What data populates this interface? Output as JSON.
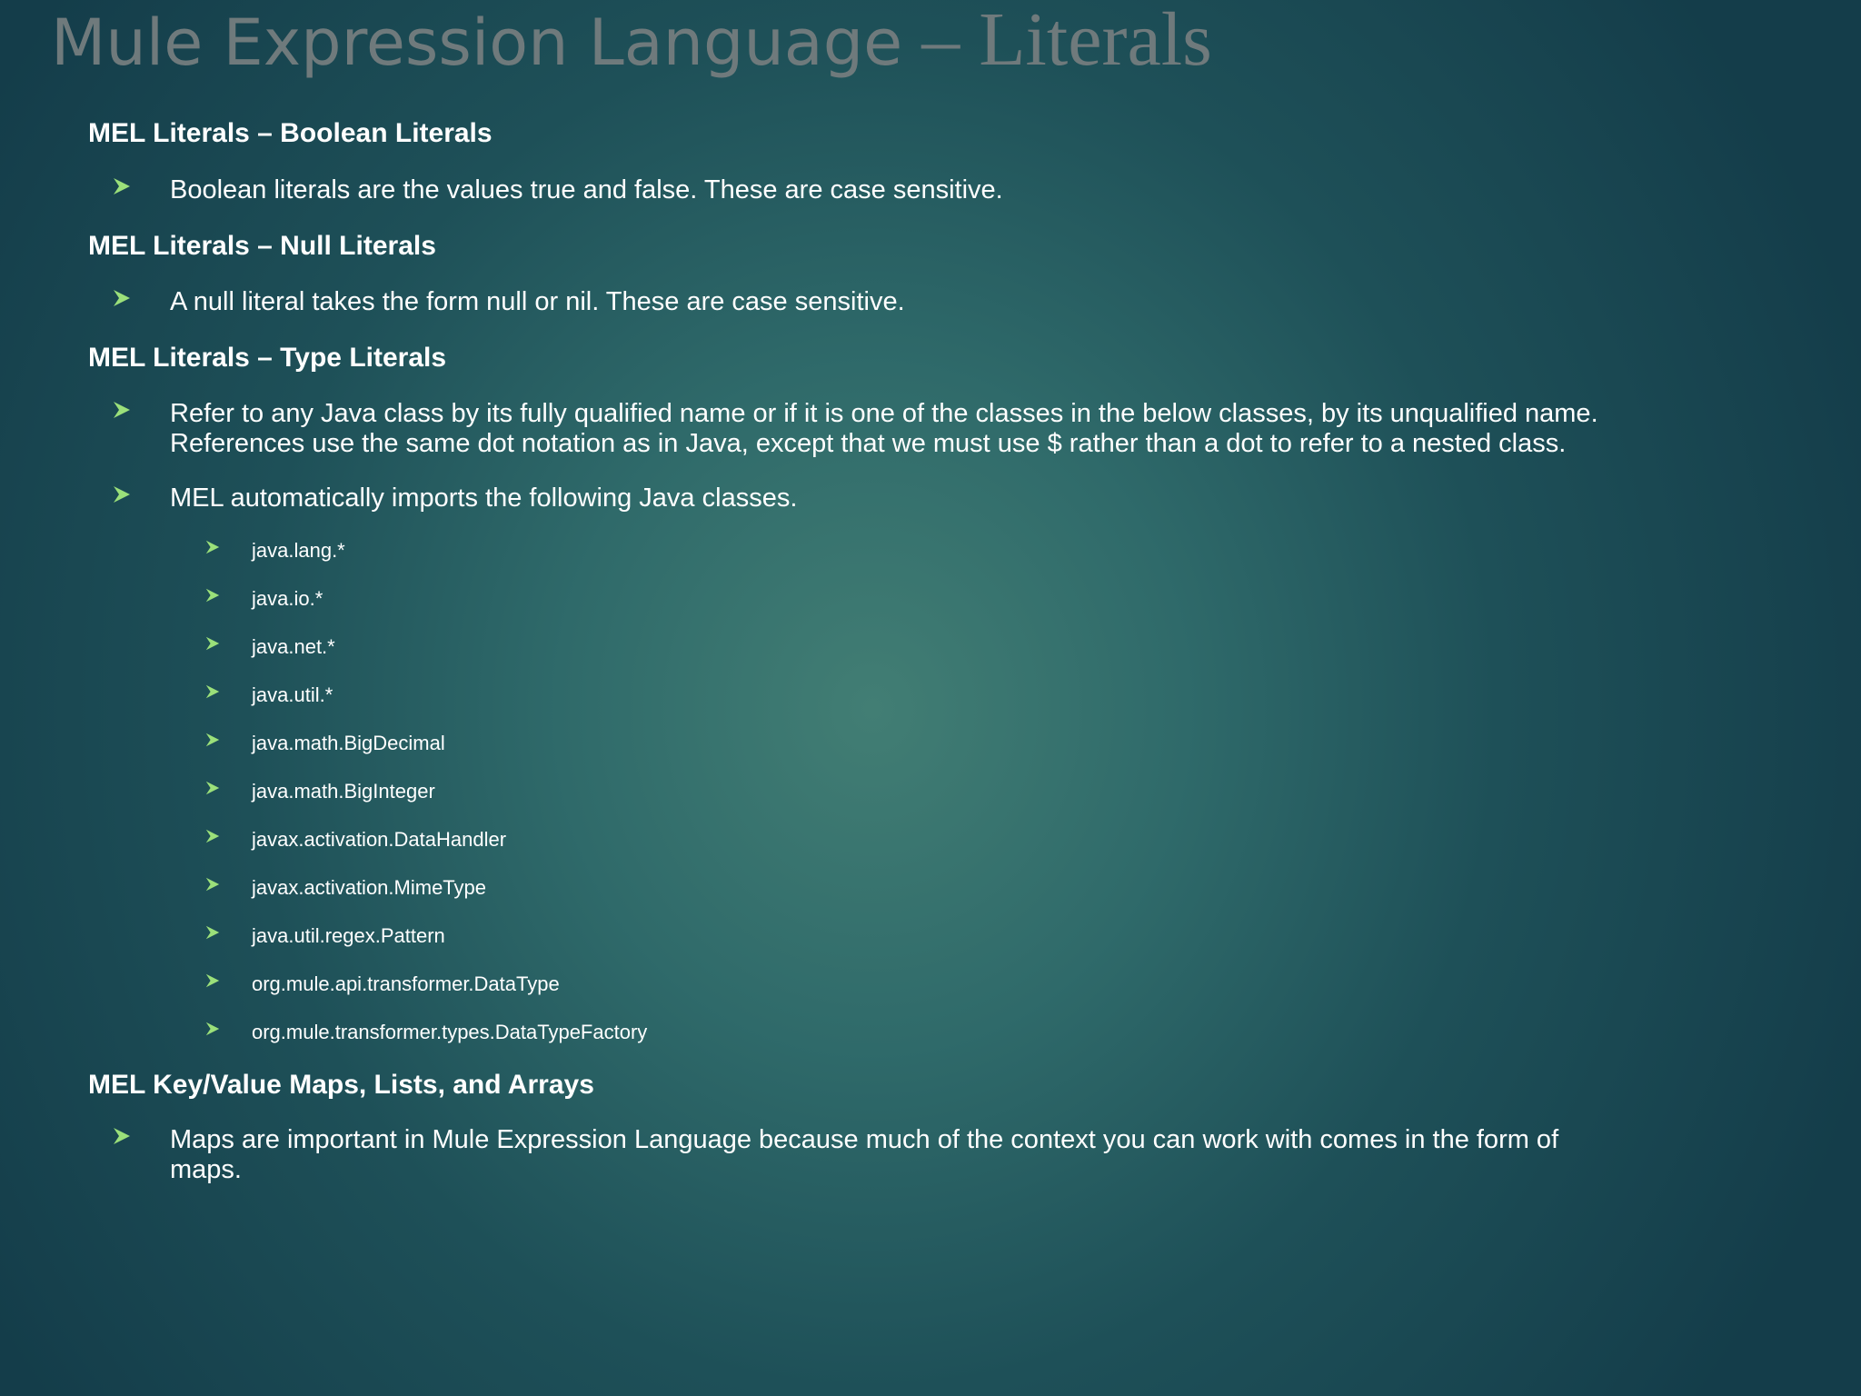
{
  "slide": {
    "title_sans": "Mule Expression Language",
    "title_serif": " – Literals",
    "sections": [
      {
        "heading": "MEL Literals – Boolean Literals",
        "bullets": [
          {
            "lines": [
              "Boolean literals are the values true and false. These are case sensitive."
            ]
          }
        ]
      },
      {
        "heading": "MEL Literals – Null Literals",
        "bullets": [
          {
            "lines": [
              "A null literal takes the form null or nil. These are case sensitive."
            ]
          }
        ]
      },
      {
        "heading": "MEL Literals – Type Literals",
        "bullets": [
          {
            "lines": [
              "Refer to any Java class by its fully qualified name or if it is one of the classes in the below classes, by its unqualified name.",
              "References use the same dot notation as in Java, except that we must use $ rather than a dot to refer to a nested class."
            ]
          },
          {
            "lines": [
              "MEL automatically imports the following Java classes."
            ]
          }
        ],
        "sub_items": [
          "java.lang.*",
          "java.io.*",
          "java.net.*",
          "java.util.*",
          "java.math.BigDecimal",
          "java.math.BigInteger",
          "javax.activation.DataHandler",
          "javax.activation.MimeType",
          "java.util.regex.Pattern",
          "org.mule.api.transformer.DataType",
          "org.mule.transformer.types.DataTypeFactory"
        ]
      },
      {
        "heading": "MEL Key/Value Maps, Lists, and Arrays",
        "bullets": [
          {
            "lines": [
              "Maps are important in Mule Expression Language because much of the context you can work with comes in the form of",
              "maps."
            ]
          }
        ]
      }
    ]
  },
  "colors": {
    "title": "#6f7a7c",
    "bullet_mark": "#9be07a",
    "text": "#ffffff"
  },
  "icons": {
    "bullet": "arrowhead-bullet-icon"
  }
}
